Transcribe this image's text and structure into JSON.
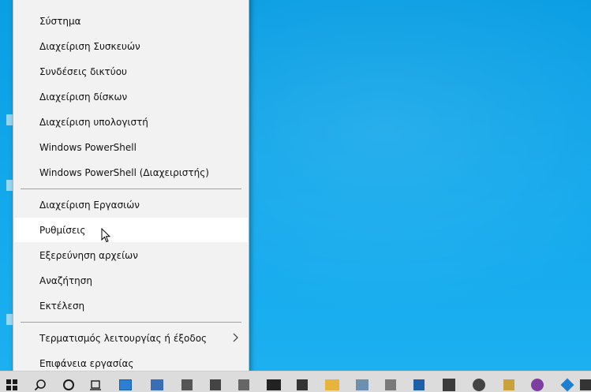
{
  "menu": {
    "items": [
      {
        "label": "Σύστημα"
      },
      {
        "label": "Διαχείριση Συσκευών"
      },
      {
        "label": "Συνδέσεις δικτύου"
      },
      {
        "label": "Διαχείριση δίσκων"
      },
      {
        "label": "Διαχείριση υπολογιστή"
      },
      {
        "label": "Windows PowerShell"
      },
      {
        "label": "Windows PowerShell (Διαχειριστής)"
      },
      {
        "label": "Διαχείριση Εργασιών"
      },
      {
        "label": "Ρυθμίσεις"
      },
      {
        "label": "Εξερεύνηση αρχείων"
      },
      {
        "label": "Αναζήτηση"
      },
      {
        "label": "Εκτέλεση"
      },
      {
        "label": "Τερματισμός λειτουργίας ή έξοδος"
      },
      {
        "label": "Επιφάνεια εργασίας"
      }
    ],
    "hovered_item": "Ρυθμίσεις"
  },
  "taskbar": {
    "icons": [
      {
        "name": "start-icon",
        "color": "#1b1b1b"
      },
      {
        "name": "search-icon",
        "color": "#1b1b1b"
      },
      {
        "name": "cortana-icon",
        "color": "#1b1b1b"
      },
      {
        "name": "task-view-icon",
        "color": "#1b1b1b"
      },
      {
        "name": "app-icon-1",
        "color": "#2d7fd3"
      },
      {
        "name": "app-icon-2",
        "color": "#3a6fb8"
      },
      {
        "name": "app-icon-3",
        "color": "#555555"
      },
      {
        "name": "app-icon-4",
        "color": "#444444"
      },
      {
        "name": "app-icon-5",
        "color": "#666666"
      },
      {
        "name": "app-icon-6",
        "color": "#222222"
      },
      {
        "name": "app-icon-7",
        "color": "#333333"
      },
      {
        "name": "folder-icon",
        "color": "#e7b43c"
      },
      {
        "name": "app-icon-8",
        "color": "#6c8fb0"
      },
      {
        "name": "app-icon-9",
        "color": "#7a7a7a"
      },
      {
        "name": "app-icon-10",
        "color": "#1d5fa8"
      },
      {
        "name": "app-icon-11",
        "color": "#3c3c3c"
      },
      {
        "name": "app-icon-12",
        "color": "#444444"
      },
      {
        "name": "app-icon-13",
        "color": "#c9a23c"
      },
      {
        "name": "app-icon-14",
        "color": "#7d3fa0"
      },
      {
        "name": "app-icon-15",
        "color": "#1e7fd0"
      },
      {
        "name": "app-icon-16",
        "color": "#333333"
      }
    ]
  }
}
